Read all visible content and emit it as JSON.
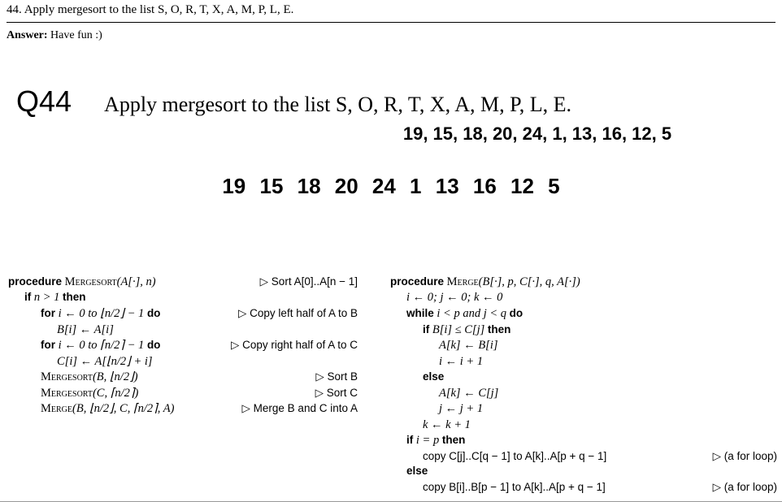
{
  "top": {
    "number": "44.",
    "question": "Apply mergesort to the list S, O, R, T, X, A, M, P, L, E.",
    "answer_label": "Answer:",
    "answer_text": "Have fun :)"
  },
  "slide": {
    "qlabel": "Q44",
    "title": "Apply mergesort to the list S, O, R, T, X, A, M, P, L, E.",
    "numbers_line": "19, 15, 18, 20, 24, 1, 13, 16, 12, 5",
    "big_sequence": "19  15  18  20  24  1  13  16  12   5"
  },
  "mergesort": {
    "l1_proc": "procedure",
    "l1_name": "Mergesort",
    "l1_args": "(A[·], n)",
    "l1_cmt": "▷ Sort A[0]..A[n − 1]",
    "l2_if": "if",
    "l2_cond": " n > 1 ",
    "l2_then": "then",
    "l3_for": "for",
    "l3_body": " i ← 0 to ⌊n/2⌋ − 1 ",
    "l3_do": "do",
    "l3_cmt": "▷ Copy left half of A to B",
    "l4": "B[i] ← A[i]",
    "l5_for": "for",
    "l5_body": " i ← 0 to ⌈n/2⌉ − 1 ",
    "l5_do": "do",
    "l5_cmt": "▷ Copy right half of A to C",
    "l6": "C[i] ← A[⌊n/2⌋ + i]",
    "l7_name": "Mergesort",
    "l7_args": "(B, ⌊n/2⌋)",
    "l7_cmt": "▷ Sort B",
    "l8_name": "Mergesort",
    "l8_args": "(C, ⌈n/2⌉)",
    "l8_cmt": "▷ Sort C",
    "l9_name": "Merge",
    "l9_args": "(B, ⌊n/2⌋, C, ⌈n/2⌉, A)",
    "l9_cmt": "▷ Merge B and C into A"
  },
  "merge": {
    "l1_proc": "procedure",
    "l1_name": "Merge",
    "l1_args": "(B[·], p, C[·], q, A[·])",
    "l2": "i ← 0; j ← 0; k ← 0",
    "l3_while": "while",
    "l3_cond": " i < p and j < q ",
    "l3_do": "do",
    "l4_if": "if",
    "l4_cond": " B[i] ≤ C[j] ",
    "l4_then": "then",
    "l5": "A[k] ← B[i]",
    "l6": "i ← i + 1",
    "l7_else": "else",
    "l8": "A[k] ← C[j]",
    "l9": "j ← j + 1",
    "l10": "k ← k + 1",
    "l11_if": "if",
    "l11_cond": " i = p ",
    "l11_then": "then",
    "l12": "copy C[j]..C[q − 1] to A[k]..A[p + q − 1]",
    "l12_cmt": "▷ (a for loop)",
    "l13_else": "else",
    "l14": "copy B[i]..B[p − 1] to A[k]..A[p + q − 1]",
    "l14_cmt": "▷ (a for loop)"
  }
}
